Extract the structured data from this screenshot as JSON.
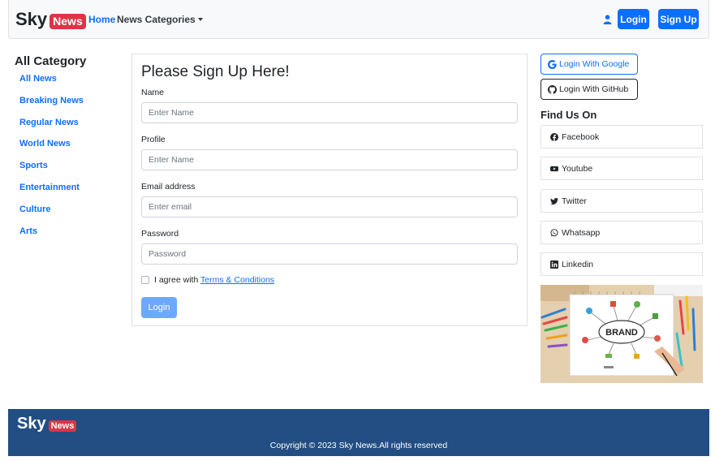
{
  "navbar": {
    "brand_sky": "Sky",
    "brand_news": "News",
    "home": "Home",
    "categories": "News Categories",
    "login": "Login",
    "signup": "Sign Up"
  },
  "sidebar": {
    "title": "All Category",
    "items": [
      "All News",
      "Breaking News",
      "Regular News",
      "World News",
      "Sports",
      "Entertainment",
      "Culture",
      "Arts"
    ]
  },
  "form": {
    "title": "Please Sign Up Here!",
    "name_label": "Name",
    "name_placeholder": "Enter Name",
    "profile_label": "Profile",
    "profile_placeholder": "Enter Name",
    "email_label": "Email address",
    "email_placeholder": "Enter email",
    "password_label": "Password",
    "password_placeholder": "Password",
    "agree_text": "I agree with ",
    "terms_link": "Terms & Conditions",
    "submit": "Login"
  },
  "right": {
    "google": "Login With Google",
    "github": "Login With GitHub",
    "find_title": "Find Us On",
    "social": [
      "Facebook",
      "Youtube",
      "Twitter",
      "Whatsapp",
      "Linkedin"
    ],
    "image_text": "BRAND"
  },
  "footer": {
    "brand_sky": "Sky",
    "brand_news": "News",
    "copyright": "Copyright © 2023 Sky News.All rights reserved"
  },
  "colors": {
    "primary": "#0d6efd",
    "news_badge": "#dc3545",
    "footer_bg": "#234e83"
  }
}
